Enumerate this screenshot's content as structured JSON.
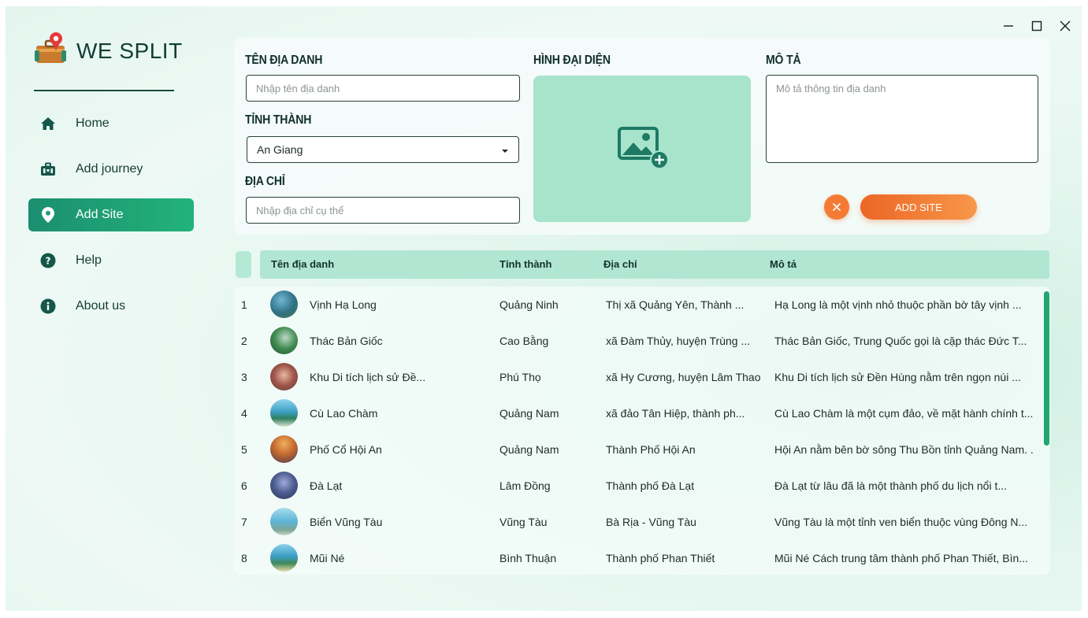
{
  "app": {
    "title": "WE SPLIT"
  },
  "nav": [
    {
      "label": "Home",
      "icon": "home-icon",
      "active": false
    },
    {
      "label": "Add journey",
      "icon": "briefcase-icon",
      "active": false
    },
    {
      "label": "Add Site",
      "icon": "location-pin-icon",
      "active": true
    },
    {
      "label": "Help",
      "icon": "help-circle-icon",
      "active": false
    },
    {
      "label": "About us",
      "icon": "info-circle-icon",
      "active": false
    }
  ],
  "form": {
    "name_label": "TÊN ĐỊA DANH",
    "name_placeholder": "Nhập tên địa danh",
    "province_label": "TỈNH THÀNH",
    "province_value": "An Giang",
    "address_label": "ĐỊA CHỈ",
    "address_placeholder": "Nhập địa chỉ cụ thể",
    "image_label": "HÌNH ĐẠI DIỆN",
    "desc_label": "MÔ TẢ",
    "desc_placeholder": "Mô tả thông tin địa danh",
    "add_button": "ADD SITE"
  },
  "table": {
    "headers": [
      "Tên địa danh",
      "Tỉnh thành",
      "Địa chỉ",
      "Mô tả"
    ],
    "rows": [
      {
        "index": "1",
        "name": "Vịnh Hạ Long",
        "province": "Quảng Ninh",
        "address": " Thị xã Quảng Yên, Thành ...",
        "desc": "Hạ Long là một vịnh nhỏ thuộc phần bờ tây vịnh ..."
      },
      {
        "index": "2",
        "name": "Thác Bản Giốc",
        "province": "Cao Bằng",
        "address": "xã Đàm Thủy, huyện Trùng ...",
        "desc": "Thác Bản Giốc, Trung Quốc gọi là cặp thác Đức T..."
      },
      {
        "index": "3",
        "name": "Khu Di tích lịch sử Đề...",
        "province": "Phú Thọ",
        "address": "xã Hy Cương, huyện Lâm Thao",
        "desc": "Khu Di tích lịch sử Đền Hùng nằm trên ngọn núi ..."
      },
      {
        "index": "4",
        "name": "Cù Lao Chàm",
        "province": "Quảng Nam",
        "address": "xã đảo Tân Hiệp, thành ph...",
        "desc": "Cù Lao Chàm là một cụm đảo, về mặt hành chính t..."
      },
      {
        "index": "5",
        "name": "Phố Cổ Hội An",
        "province": "Quảng Nam",
        "address": "Thành Phố Hội An",
        "desc": "Hội An nằm bên bờ sông Thu Bồn tỉnh Quảng Nam. ."
      },
      {
        "index": "6",
        "name": "Đà Lạt",
        "province": "Lâm Đồng",
        "address": "Thành phố Đà Lạt",
        "desc": "Đà Lạt từ lâu đã là một thành phố du lịch nổi t..."
      },
      {
        "index": "7",
        "name": "Biển Vũng Tàu",
        "province": "Vũng Tàu",
        "address": "Bà Rịa - Vũng Tàu",
        "desc": "Vũng Tàu là một tỉnh ven biển thuộc vùng Đông N..."
      },
      {
        "index": "8",
        "name": "Mũi Né",
        "province": "Bình Thuận",
        "address": "Thành phố Phan Thiết",
        "desc": "Mũi Né Cách trung tâm thành phố Phan Thiết, Bìn..."
      }
    ]
  },
  "colors": {
    "accent": "#1b8e6f",
    "orange": "#f47b35",
    "image_bg": "#a8e3cc",
    "header_bg": "#b1e6d3"
  }
}
